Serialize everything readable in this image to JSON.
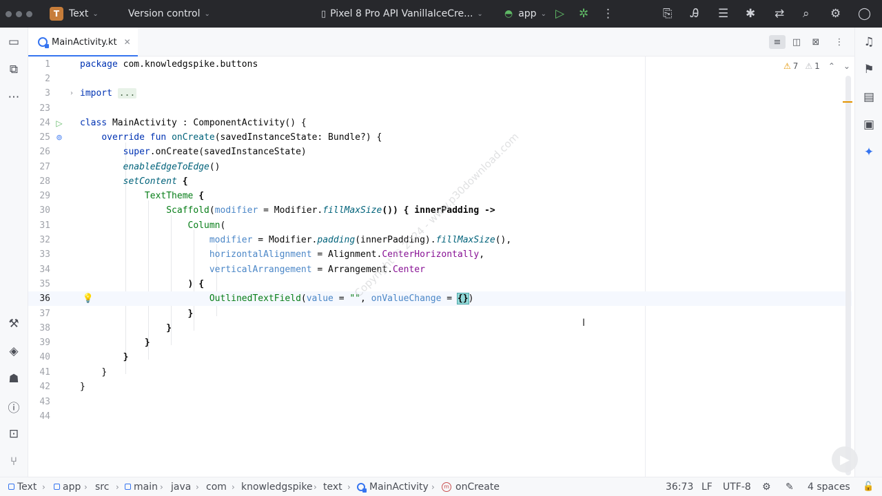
{
  "titlebar": {
    "project_badge": "T",
    "project_name": "Text",
    "vcs": "Version control",
    "device": "Pixel 8 Pro API VanillaIceCre...",
    "run_config": "app"
  },
  "tabs": [
    {
      "label": "MainActivity.kt",
      "close": "✕",
      "active": true
    }
  ],
  "editor": {
    "warnings": "7",
    "weak_warnings": "1",
    "lines": [
      {
        "n": "1"
      },
      {
        "n": "2"
      },
      {
        "n": "3"
      },
      {
        "n": "23"
      },
      {
        "n": "24"
      },
      {
        "n": "25"
      },
      {
        "n": "26"
      },
      {
        "n": "27"
      },
      {
        "n": "28"
      },
      {
        "n": "29"
      },
      {
        "n": "30"
      },
      {
        "n": "31"
      },
      {
        "n": "32"
      },
      {
        "n": "33"
      },
      {
        "n": "34"
      },
      {
        "n": "35"
      },
      {
        "n": "36"
      },
      {
        "n": "37"
      },
      {
        "n": "38"
      },
      {
        "n": "39"
      },
      {
        "n": "40"
      },
      {
        "n": "41"
      },
      {
        "n": "42"
      },
      {
        "n": "43"
      },
      {
        "n": "44"
      }
    ],
    "code": {
      "l1_kw": "package",
      "l1_rest": " com.knowledgspike.buttons",
      "l3_kw": "import",
      "l3_fold": "...",
      "l24_kw": "class",
      "l24_rest": " MainActivity : ComponentActivity() {",
      "l25_kw": "override fun",
      "l25_fn": "onCreate",
      "l25_rest": "(savedInstanceState: Bundle?) {",
      "l26_kw": "super",
      "l26_rest": ".onCreate(savedInstanceState)",
      "l27_fn": "enableEdgeToEdge",
      "l27_rest": "()",
      "l28_fn": "setContent",
      "l28_rest": " {",
      "l29_comp": "TextTheme",
      "l29_rest": " {",
      "l30_comp": "Scaffold",
      "l30_p1": "(",
      "l30_named": "modifier",
      "l30_eq": " = Modifier.",
      "l30_fn": "fillMaxSize",
      "l30_rest": "()) { innerPadding ->",
      "l31_comp": "Column",
      "l31_rest": "(",
      "l32_named": "modifier",
      "l32_eq": " = Modifier.",
      "l32_fn1": "padding",
      "l32_mid": "(innerPadding).",
      "l32_fn2": "fillMaxSize",
      "l32_rest": "(),",
      "l33_named": "horizontalAlignment",
      "l33_eq": " = Alignment.",
      "l33_prop": "CenterHorizontally",
      "l33_rest": ",",
      "l34_named": "verticalArrangement",
      "l34_eq": " = Arrangement.",
      "l34_prop": "Center",
      "l35": ") {",
      "l36_comp": "OutlinedTextField",
      "l36_p1": "(",
      "l36_named1": "value",
      "l36_eq1": " = ",
      "l36_str": "\"\"",
      "l36_comma": ", ",
      "l36_named2": "onValueChange",
      "l36_eq2": " = ",
      "l36_brace": "{}",
      "l36_rest": ")",
      "l37": "}",
      "l38": "}",
      "l39": "}",
      "l40": "}",
      "l41": "}",
      "l42": "}"
    }
  },
  "watermark": "Copyright © 2024 - www.p30download.com",
  "statusbar": {
    "breadcrumb": [
      "Text",
      "app",
      "src",
      "main",
      "java",
      "com",
      "knowledgspike",
      "text",
      "MainActivity",
      "onCreate"
    ],
    "position": "36:73",
    "line_sep": "LF",
    "encoding": "UTF-8",
    "indent": "4 spaces"
  },
  "colors": {
    "accent": "#3574f0",
    "titlebar": "#27282c",
    "warning": "#e39400"
  }
}
